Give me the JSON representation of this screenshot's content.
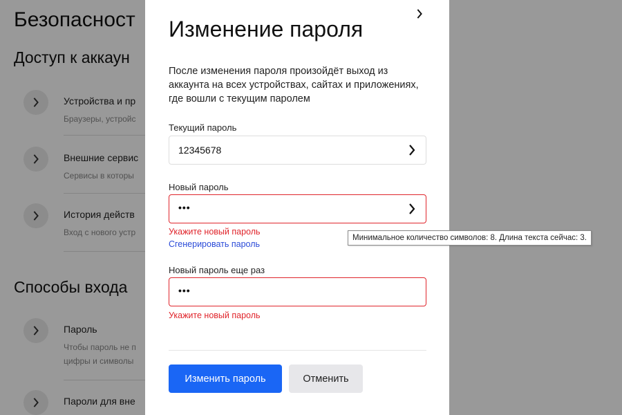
{
  "background_page": {
    "title": "Безопасност",
    "section_access": "Доступ к аккаун",
    "access_items": [
      {
        "title": "Устройства и пр",
        "subtitle": "Браузеры, устройс"
      },
      {
        "title": "Внешние сервис",
        "subtitle": "Сервисы в которы"
      },
      {
        "title": "История действ",
        "subtitle": "Вход с нового устр"
      }
    ],
    "section_login": "Способы входа",
    "login_items": [
      {
        "title": "Пароль",
        "subtitle_line1": "Чтобы пароль не п",
        "subtitle_line2": "цифры и символы"
      },
      {
        "title": "Пароли для вне"
      }
    ]
  },
  "modal": {
    "title": "Изменение пароля",
    "description": "После изменения пароля произойдёт выход из аккаунта на всех устройствах, сайтах и приложениях, где вошли с текущим паролем",
    "current_password": {
      "label": "Текущий пароль",
      "value": "12345678"
    },
    "new_password": {
      "label": "Новый пароль",
      "value": "•••",
      "error": "Укажите новый пароль",
      "generate_link": "Сгенерировать пароль"
    },
    "repeat_password": {
      "label": "Новый пароль еще раз",
      "value": "•••",
      "error": "Укажите новый пароль"
    },
    "submit_label": "Изменить пароль",
    "cancel_label": "Отменить"
  },
  "tooltip": "Минимальное количество символов: 8. Длина текста сейчас: 3.",
  "colors": {
    "accent": "#1a66f5",
    "error": "#e0242b",
    "link": "#2b4bd8"
  }
}
